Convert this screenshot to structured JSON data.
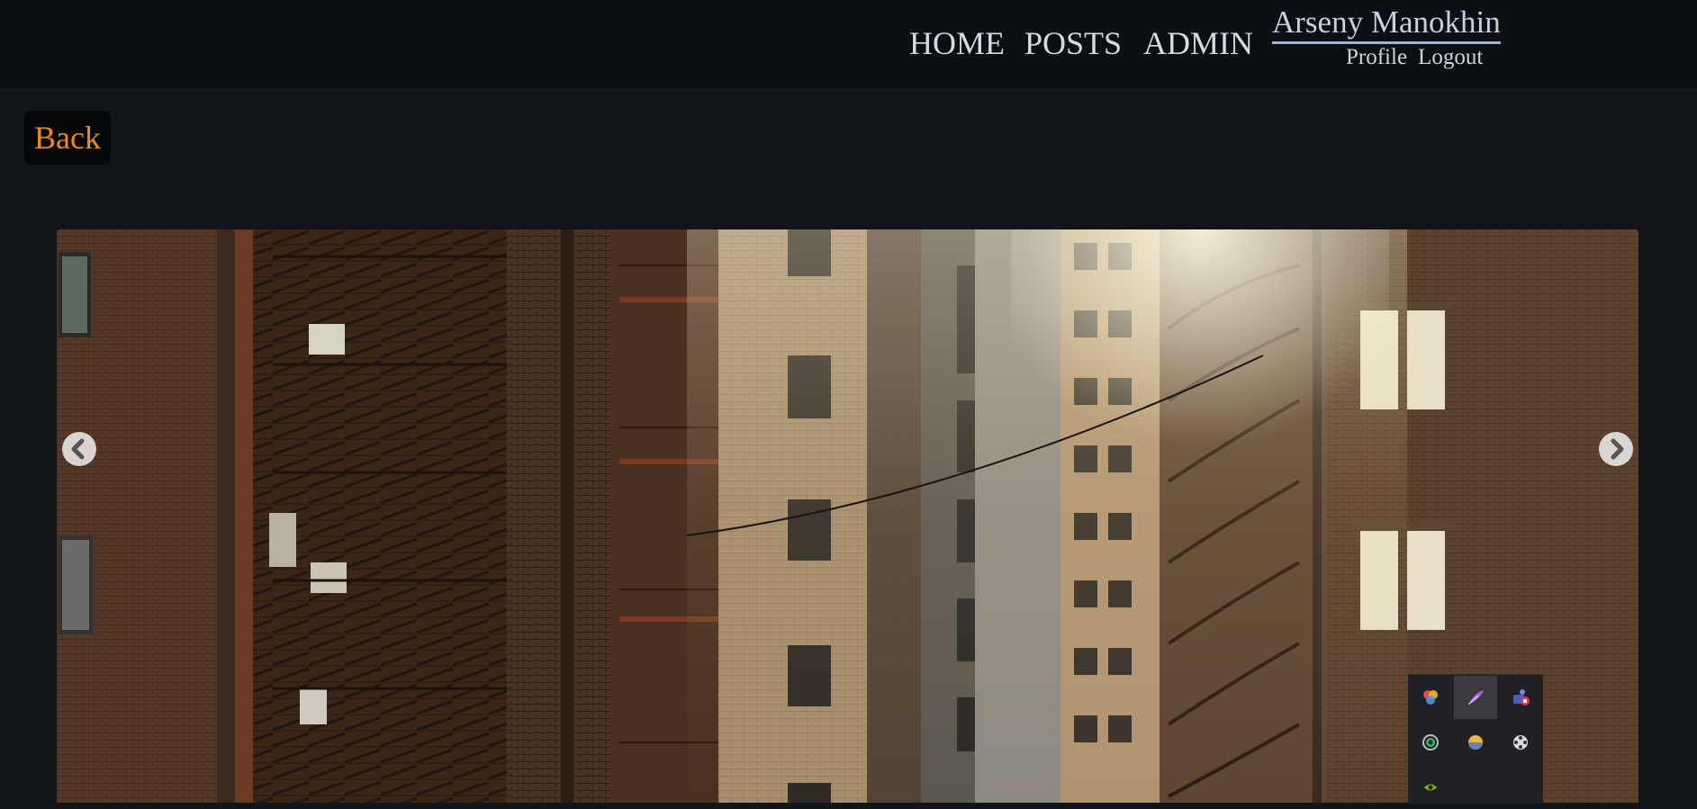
{
  "nav": {
    "home": "HOME",
    "posts": "POSTS",
    "admin": "ADMIN"
  },
  "user": {
    "name": "Arseny Manokhin",
    "profile": "Profile",
    "logout": "Logout"
  },
  "back_label": "Back",
  "carousel": {
    "image": "city-alley-fire-escapes",
    "prev_icon": "chevron-left-icon",
    "next_icon": "chevron-right-icon"
  },
  "tray": {
    "icons": [
      "color-wheel-icon",
      "feather-icon",
      "teams-icon",
      "target-icon",
      "half-moon-icon",
      "film-reel-icon",
      "nvidia-icon"
    ]
  },
  "colors": {
    "topbar_bg": "#0b0e12",
    "page_bg": "#111519",
    "back_text": "#f08a16",
    "nav_text": "#d6dbe2",
    "user_link": "#c8cfe0"
  }
}
